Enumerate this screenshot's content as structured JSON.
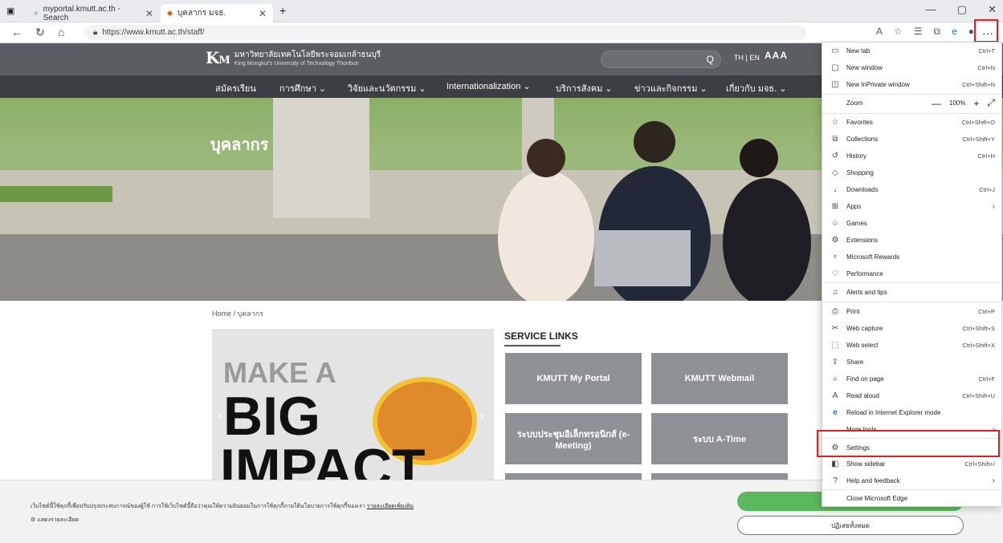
{
  "browser": {
    "tabs": [
      {
        "title": "myportal.kmutt.ac.th - Search",
        "active": false
      },
      {
        "title": "บุคลากร มจธ.",
        "active": true
      }
    ],
    "new_tab": "+",
    "url": "https://www.kmutt.ac.th/staff/",
    "more_button": "···",
    "window_controls": [
      "—",
      "▢",
      "✕"
    ]
  },
  "site": {
    "logo_mark": "KMUTT",
    "logo_thai": "มหาวิทยาลัยเทคโนโลยีพระจอมเกล้าธนบุรี",
    "logo_en": "King Mongkut's University of Technology Thonburi",
    "search_icon": "Q",
    "lang": "TH | EN",
    "font_size": "AAA",
    "nav": [
      "สมัครเรียน",
      "การศึกษา ⌄",
      "วิจัยและนวัตกรรม ⌄",
      "Internationalization ⌄",
      "บริการสังคม ⌄",
      "ข่าวและกิจกรรม ⌄",
      "เกี่ยวกับ มจธ. ⌄"
    ],
    "hero_title": "บุคลากร",
    "breadcrumb": "Home / บุคลากร",
    "promo": {
      "line1": "MAKE A",
      "line2": "BIG",
      "line3": "IMPACT"
    },
    "service_title": "SERVICE LINKS",
    "services": [
      "KMUTT My Portal",
      "KMUTT Webmail",
      "ระบบประชุมอิเล็กทรอนิกส์ (e-Meeting)",
      "ระบบ A-Time"
    ],
    "cookie": {
      "text": "เว็บไซต์นี้ใช้คุกกี้เพื่อปรับปรุงประสบการณ์ของผู้ใช้ การใช้เว็บไซต์นี้ถือว่าคุณให้ความยินยอมในการใช้คุกกี้ภายใต้นโยบายการใช้คุกกี้ของเรา",
      "link": "รายละเอียดเพิ่มเติม",
      "settings": "แสดงรายละเอียด",
      "reject": "ปฏิเสธทั้งหมด"
    }
  },
  "menu": {
    "items": [
      {
        "icon": "▭",
        "label": "New tab",
        "shortcut": "Ctrl+T"
      },
      {
        "icon": "▢",
        "label": "New window",
        "shortcut": "Ctrl+N"
      },
      {
        "icon": "◫",
        "label": "New InPrivate window",
        "shortcut": "Ctrl+Shift+N"
      },
      {
        "icon": "",
        "label": "Zoom",
        "shortcut": ""
      },
      {
        "icon": "☆",
        "label": "Favorites",
        "shortcut": "Ctrl+Shift+O"
      },
      {
        "icon": "⧉",
        "label": "Collections",
        "shortcut": "Ctrl+Shift+Y"
      },
      {
        "icon": "↺",
        "label": "History",
        "shortcut": "Ctrl+H"
      },
      {
        "icon": "◇",
        "label": "Shopping",
        "shortcut": ""
      },
      {
        "icon": "↓",
        "label": "Downloads",
        "shortcut": "Ctrl+J"
      },
      {
        "icon": "⊞",
        "label": "Apps",
        "shortcut": ""
      },
      {
        "icon": "♧",
        "label": "Games",
        "shortcut": ""
      },
      {
        "icon": "⚙",
        "label": "Extensions",
        "shortcut": ""
      },
      {
        "icon": "♆",
        "label": "Microsoft Rewards",
        "shortcut": ""
      },
      {
        "icon": "♡",
        "label": "Performance",
        "shortcut": ""
      },
      {
        "icon": "♫",
        "label": "Alerts and tips",
        "shortcut": ""
      },
      {
        "icon": "⎙",
        "label": "Print",
        "shortcut": "Ctrl+P"
      },
      {
        "icon": "✂",
        "label": "Web capture",
        "shortcut": "Ctrl+Shift+S"
      },
      {
        "icon": "⬚",
        "label": "Web select",
        "shortcut": "Ctrl+Shift+X"
      },
      {
        "icon": "⇪",
        "label": "Share",
        "shortcut": ""
      },
      {
        "icon": "⌕",
        "label": "Find on page",
        "shortcut": "Ctrl+F"
      },
      {
        "icon": "A",
        "label": "Read aloud",
        "shortcut": "Ctrl+Shift+U"
      },
      {
        "icon": "e",
        "label": "Reload in Internet Explorer mode",
        "shortcut": ""
      },
      {
        "icon": "",
        "label": "More tools",
        "shortcut": ""
      },
      {
        "icon": "⚙",
        "label": "Settings",
        "shortcut": ""
      },
      {
        "icon": "◧",
        "label": "Show sidebar",
        "shortcut": "Ctrl+Shift+/"
      },
      {
        "icon": "?",
        "label": "Help and feedback",
        "shortcut": ""
      },
      {
        "icon": "",
        "label": "Close Microsoft Edge",
        "shortcut": ""
      }
    ],
    "zoom_value": "100%",
    "zoom_minus": "—",
    "zoom_plus": "+",
    "zoom_full": "⤢",
    "submenu_arrow": "›"
  }
}
